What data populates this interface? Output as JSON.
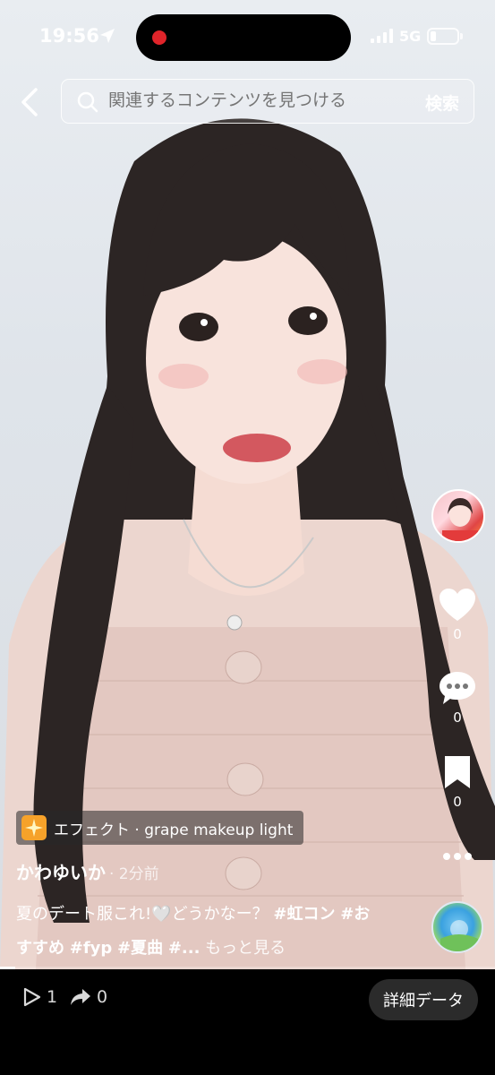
{
  "status_bar": {
    "time": "19:56",
    "network": "5G",
    "battery_level": 0.2
  },
  "search": {
    "placeholder": "関連するコンテンツを見つける",
    "button_label": "検索"
  },
  "actions": {
    "likes": "0",
    "comments": "0",
    "saves": "0"
  },
  "effect": {
    "label": "エフェクト · grape makeup light"
  },
  "post": {
    "username": "かわゆいか",
    "time_ago": "· 2分前",
    "caption_text": "夏のデート服これ!🤍どうかなー？ ",
    "tags": [
      "#虹コン",
      "#おすすめ",
      "#fyp",
      "#夏曲",
      "#..."
    ],
    "more_label": "もっと見る",
    "progress": 0.03
  },
  "bottom_bar": {
    "plays": "1",
    "shares": "0",
    "details_label": "詳細データ"
  },
  "colors": {
    "record_dot": "#e0242a",
    "effect_badge": "#f6a22a"
  }
}
